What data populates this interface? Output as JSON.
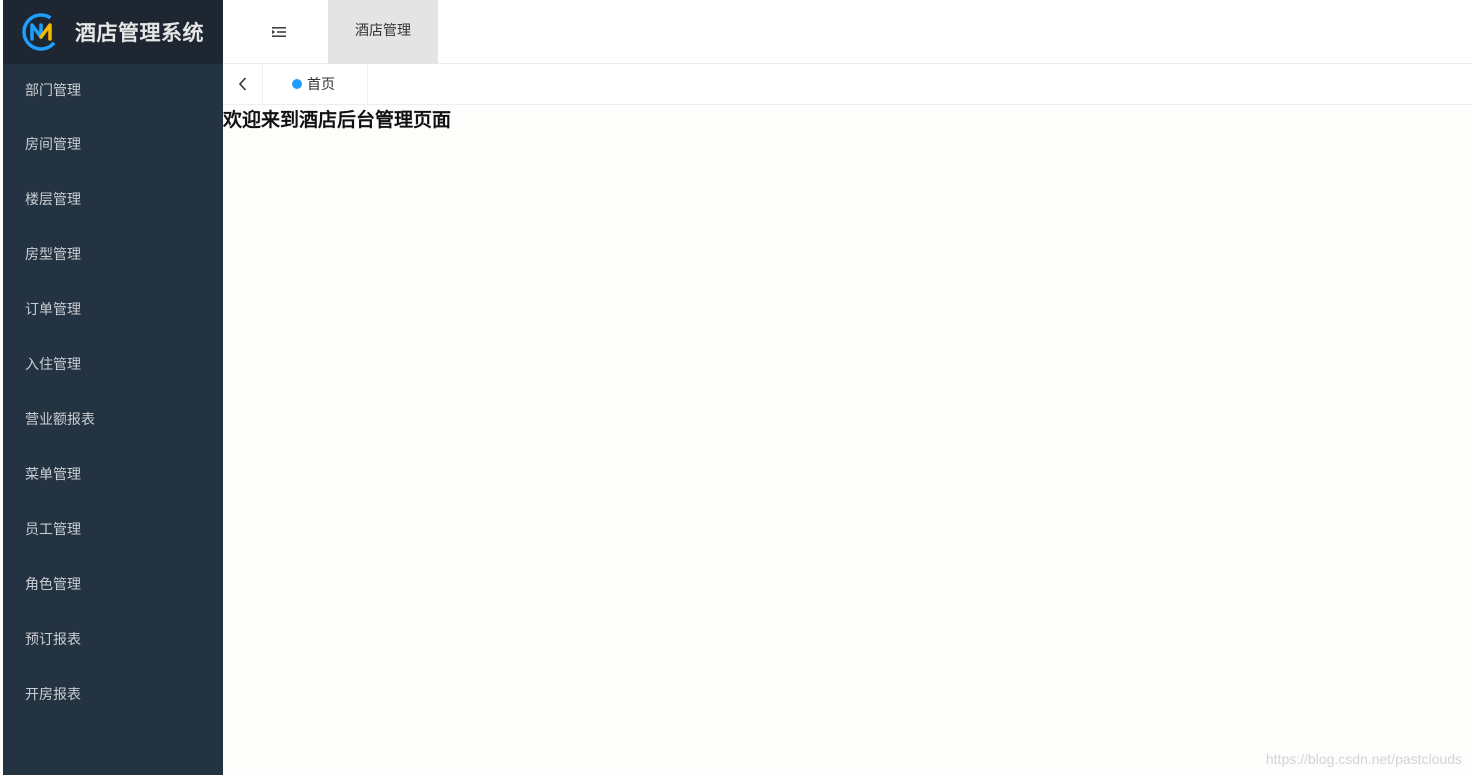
{
  "app": {
    "title": "酒店管理系统",
    "logo_icon": "hotel-logo-icon"
  },
  "sidebar": {
    "items": [
      {
        "label": "部门管理"
      },
      {
        "label": "房间管理"
      },
      {
        "label": "楼层管理"
      },
      {
        "label": "房型管理"
      },
      {
        "label": "订单管理"
      },
      {
        "label": "入住管理"
      },
      {
        "label": "营业额报表"
      },
      {
        "label": "菜单管理"
      },
      {
        "label": "员工管理"
      },
      {
        "label": "角色管理"
      },
      {
        "label": "预订报表"
      },
      {
        "label": "开房报表"
      }
    ]
  },
  "header": {
    "toggle_icon": "menu-fold-icon",
    "tab_label": "酒店管理"
  },
  "tabs": {
    "prev_icon": "chevron-left-icon",
    "home_label": "首页",
    "active_dot_color": "#1e9fff"
  },
  "main": {
    "welcome_text": "欢迎来到酒店后台管理页面"
  },
  "watermark": "https://blog.csdn.net/pastclouds",
  "colors": {
    "sidebar_bg": "#243342",
    "logo_bg": "#1e2731",
    "accent": "#1e9fff"
  }
}
